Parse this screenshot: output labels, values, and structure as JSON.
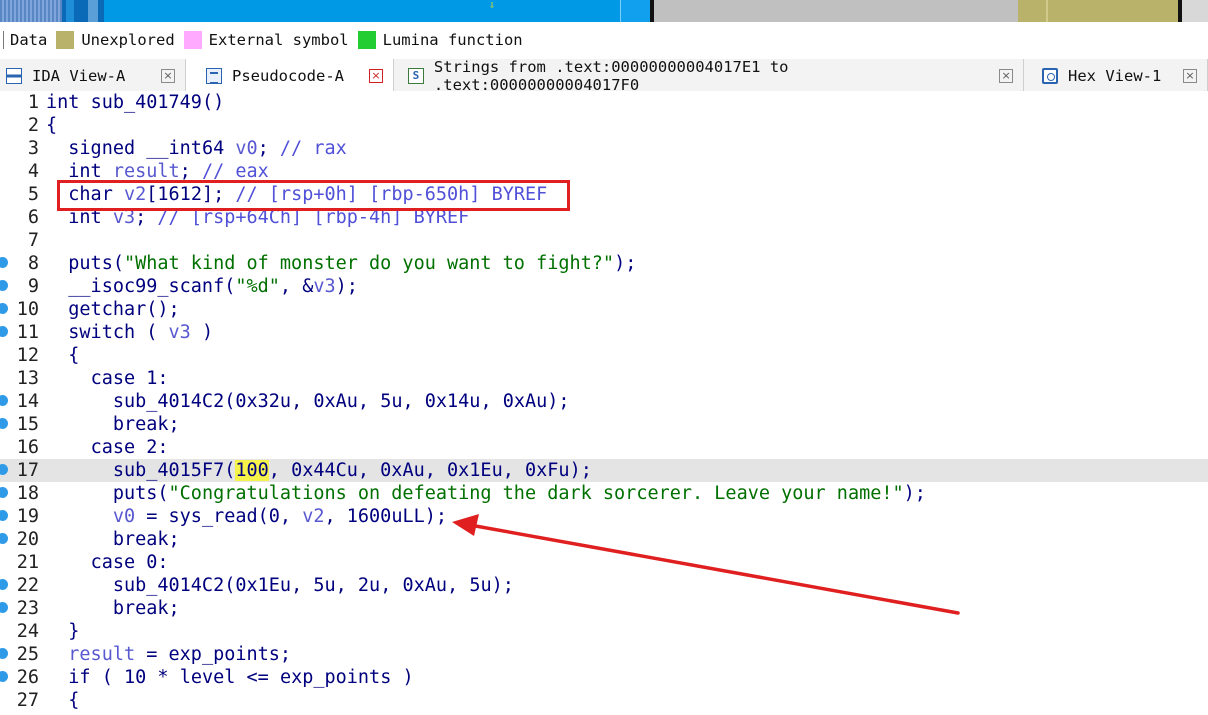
{
  "legend": {
    "items": [
      {
        "label": "Data",
        "color": null
      },
      {
        "label": "Unexplored",
        "color": "#b8b26a"
      },
      {
        "label": "External symbol",
        "color": "#ffaaff"
      },
      {
        "label": "Lumina function",
        "color": "#22cc33"
      }
    ]
  },
  "tabs": [
    {
      "label": "IDA View-A",
      "icon": "ida-view-icon",
      "active": false
    },
    {
      "label": "Pseudocode-A",
      "icon": "pseudocode-icon",
      "active": true
    },
    {
      "label": "Strings from .text:00000000004017E1 to .text:00000000004017F0",
      "icon": "strings-icon",
      "active": false
    },
    {
      "label": "Hex View-1",
      "icon": "hex-view-icon",
      "active": false
    }
  ],
  "tab_close_glyph": "×",
  "code": {
    "lines": [
      {
        "n": "1",
        "dot": false,
        "hl": false,
        "html": "int sub_401749()"
      },
      {
        "n": "2",
        "dot": false,
        "hl": false,
        "html": "{"
      },
      {
        "n": "3",
        "dot": false,
        "hl": false,
        "html": "  signed __int64 v0; // rax"
      },
      {
        "n": "4",
        "dot": false,
        "hl": false,
        "html": "  int result; // eax"
      },
      {
        "n": "5",
        "dot": false,
        "hl": false,
        "html": "  char v2[1612]; // [rsp+0h] [rbp-650h] BYREF"
      },
      {
        "n": "6",
        "dot": false,
        "hl": false,
        "html": "  int v3; // [rsp+64Ch] [rbp-4h] BYREF"
      },
      {
        "n": "7",
        "dot": false,
        "hl": false,
        "html": ""
      },
      {
        "n": "8",
        "dot": true,
        "hl": false,
        "html": "  puts(\"What kind of monster do you want to fight?\");"
      },
      {
        "n": "9",
        "dot": true,
        "hl": false,
        "html": "  __isoc99_scanf(\"%d\", &v3);"
      },
      {
        "n": "10",
        "dot": true,
        "hl": false,
        "html": "  getchar();"
      },
      {
        "n": "11",
        "dot": true,
        "hl": false,
        "html": "  switch ( v3 )"
      },
      {
        "n": "12",
        "dot": false,
        "hl": false,
        "html": "  {"
      },
      {
        "n": "13",
        "dot": false,
        "hl": false,
        "html": "    case 1:"
      },
      {
        "n": "14",
        "dot": true,
        "hl": false,
        "html": "      sub_4014C2(0x32u, 0xAu, 5u, 0x14u, 0xAu);"
      },
      {
        "n": "15",
        "dot": true,
        "hl": false,
        "html": "      break;"
      },
      {
        "n": "16",
        "dot": false,
        "hl": false,
        "html": "    case 2:"
      },
      {
        "n": "17",
        "dot": true,
        "hl": true,
        "html": "      sub_4015F7(100, 0x44Cu, 0xAu, 0x1Eu, 0xFu);"
      },
      {
        "n": "18",
        "dot": true,
        "hl": false,
        "html": "      puts(\"Congratulations on defeating the dark sorcerer. Leave your name!\");"
      },
      {
        "n": "19",
        "dot": true,
        "hl": false,
        "html": "      v0 = sys_read(0, v2, 1600uLL);"
      },
      {
        "n": "20",
        "dot": true,
        "hl": false,
        "html": "      break;"
      },
      {
        "n": "21",
        "dot": false,
        "hl": false,
        "html": "    case 0:"
      },
      {
        "n": "22",
        "dot": true,
        "hl": false,
        "html": "      sub_4014C2(0x1Eu, 5u, 2u, 0xAu, 5u);"
      },
      {
        "n": "23",
        "dot": true,
        "hl": false,
        "html": "      break;"
      },
      {
        "n": "24",
        "dot": false,
        "hl": false,
        "html": "  }"
      },
      {
        "n": "25",
        "dot": true,
        "hl": false,
        "html": "  result = exp_points;"
      },
      {
        "n": "26",
        "dot": true,
        "hl": false,
        "html": "  if ( 10 * level <= exp_points )"
      },
      {
        "n": "27",
        "dot": false,
        "hl": false,
        "html": "  {"
      }
    ]
  },
  "colors": {
    "keyword": "#00007f",
    "variable": "#5858d0",
    "comment": "#5050d8",
    "string": "#007000",
    "highlight_line": "#e4e4e4",
    "highlight_token": "#f5f24a",
    "annotation_red": "#e02020"
  }
}
